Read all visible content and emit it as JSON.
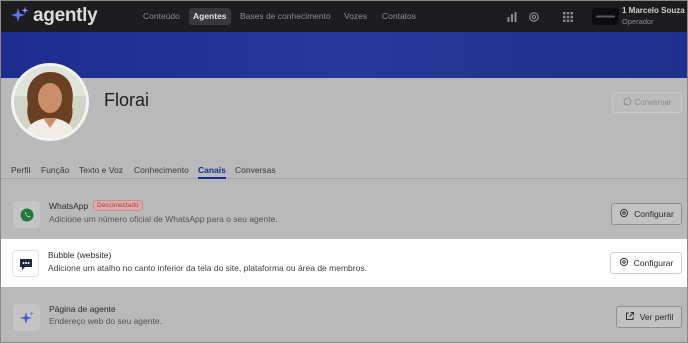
{
  "app": {
    "name": "agently"
  },
  "nav": {
    "items": [
      {
        "label": "Conteúdo",
        "active": false
      },
      {
        "label": "Agentes",
        "active": true
      },
      {
        "label": "Bases de conhecimento",
        "active": false
      },
      {
        "label": "Vozes",
        "active": false
      },
      {
        "label": "Contatos",
        "active": false
      }
    ]
  },
  "user": {
    "name": "1 Marcelo Souza",
    "role": "Operador"
  },
  "agent": {
    "name": "Florai",
    "talk_label": "Conversar"
  },
  "tabs": [
    {
      "label": "Perfil",
      "active": false
    },
    {
      "label": "Função",
      "active": false
    },
    {
      "label": "Texto e Voz",
      "active": false
    },
    {
      "label": "Conhecimento",
      "active": false
    },
    {
      "label": "Canais",
      "active": true
    },
    {
      "label": "Conversas",
      "active": false
    }
  ],
  "channels": [
    {
      "title": "WhatsApp",
      "badge": "Desconectado",
      "description": "Adicione um número oficial de WhatsApp para o seu agente.",
      "button": "Configurar",
      "icon": "whatsapp-icon"
    },
    {
      "title": "Bubble (website)",
      "description": "Adicione um atalho no canto inferior da tela do site, plataforma ou área de membros.",
      "button": "Configurar",
      "icon": "chat-bubble-icon",
      "highlighted": true
    },
    {
      "title": "Página de agente",
      "description": "Endereço web do seu agente.",
      "button": "Ver perfil",
      "icon": "sparkle-icon"
    }
  ],
  "colors": {
    "brand": "#4e6cf0",
    "nav_bg": "#1d1d20",
    "banner": "#23338f",
    "active_tab": "#1a2e8c",
    "whatsapp": "#1f7a3c",
    "badge_text": "#b13d3d"
  }
}
